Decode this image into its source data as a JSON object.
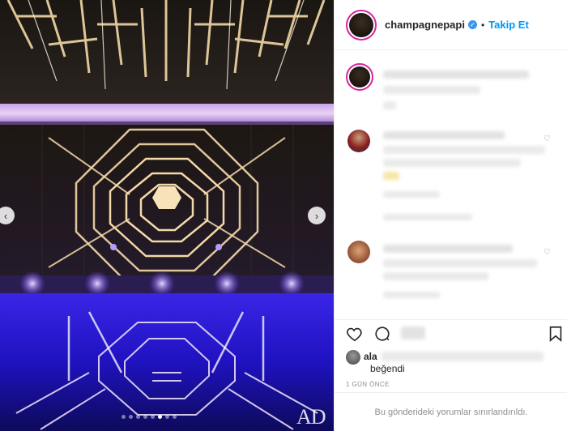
{
  "post": {
    "username": "champagnepapi",
    "follow_label": "Takip Et",
    "separator": "•",
    "verified_icon": "verified-badge-icon",
    "likes_user": "ala",
    "likes_suffix": "beğendi",
    "time": "1 GÜN ÖNCE",
    "comments_restricted": "Bu gönderideki yorumlar sınırlandırıldı.",
    "watermark": "AD"
  },
  "media": {
    "prev_icon": "‹",
    "next_icon": "›",
    "carousel_count": 8,
    "carousel_active": 5
  },
  "colors": {
    "accent": "#0095f6",
    "verified": "#3897f0",
    "neon": "#f4d9a8",
    "pool": "#2a18d8"
  }
}
